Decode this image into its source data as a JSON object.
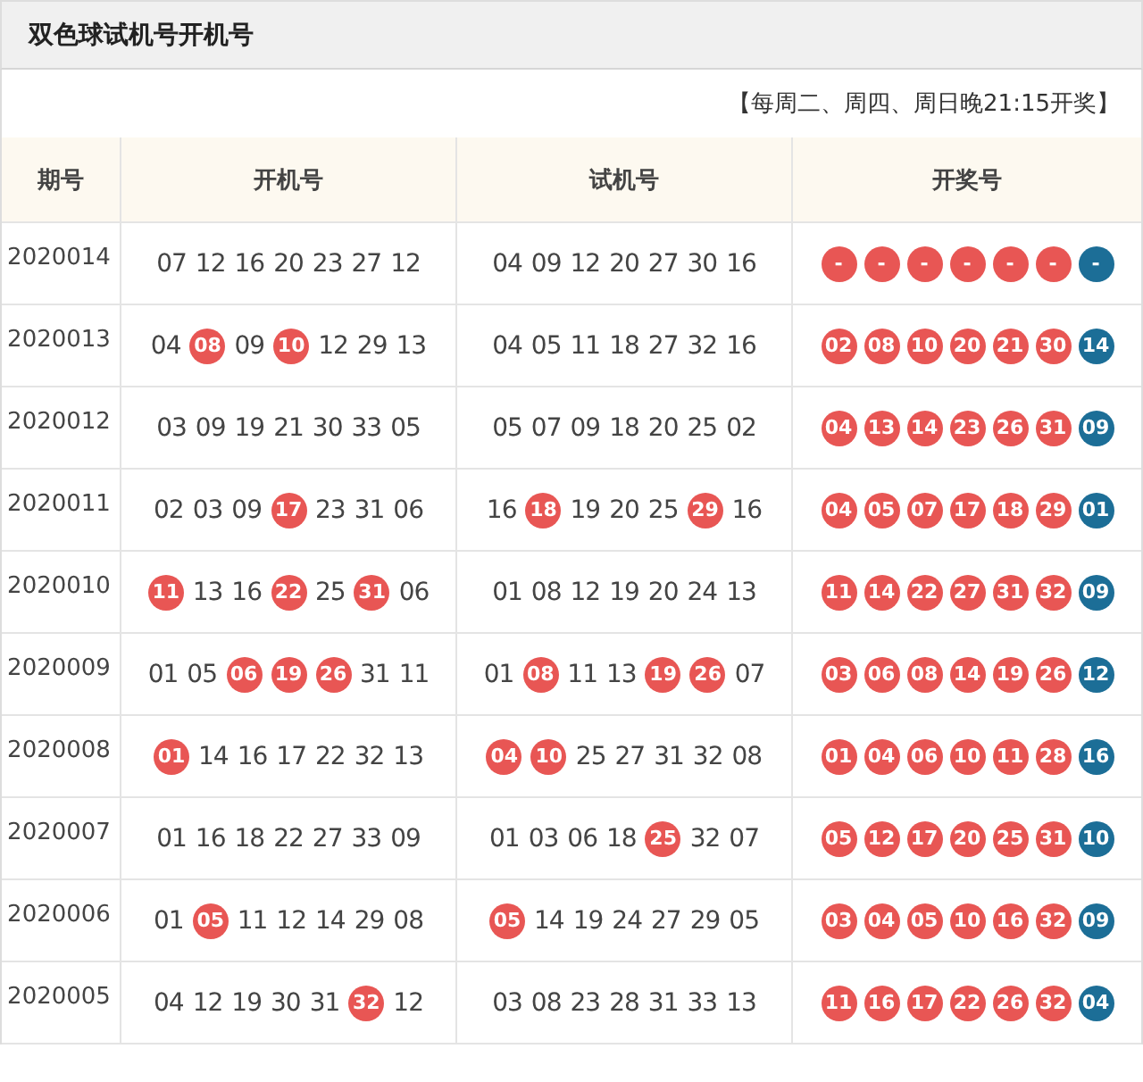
{
  "title": "双色球试机号开机号",
  "notice": "【每周二、周四、周日晚21:15开奖】",
  "columns": [
    "期号",
    "开机号",
    "试机号",
    "开奖号"
  ],
  "rows": [
    {
      "period": "2020014",
      "open": [
        {
          "n": "07",
          "hit": false
        },
        {
          "n": "12",
          "hit": false
        },
        {
          "n": "16",
          "hit": false
        },
        {
          "n": "20",
          "hit": false
        },
        {
          "n": "23",
          "hit": false
        },
        {
          "n": "27",
          "hit": false
        },
        {
          "n": "12",
          "hit": false
        }
      ],
      "test": [
        {
          "n": "04",
          "hit": false
        },
        {
          "n": "09",
          "hit": false
        },
        {
          "n": "12",
          "hit": false
        },
        {
          "n": "20",
          "hit": false
        },
        {
          "n": "27",
          "hit": false
        },
        {
          "n": "30",
          "hit": false
        },
        {
          "n": "16",
          "hit": false
        }
      ],
      "result": [
        {
          "n": "-",
          "color": "#e85654"
        },
        {
          "n": "-",
          "color": "#e85654"
        },
        {
          "n": "-",
          "color": "#e85654"
        },
        {
          "n": "-",
          "color": "#e85654"
        },
        {
          "n": "-",
          "color": "#e85654"
        },
        {
          "n": "-",
          "color": "#e85654"
        },
        {
          "n": "-",
          "color": "#1c6e97"
        }
      ]
    },
    {
      "period": "2020013",
      "open": [
        {
          "n": "04",
          "hit": false
        },
        {
          "n": "08",
          "hit": true
        },
        {
          "n": "09",
          "hit": false
        },
        {
          "n": "10",
          "hit": true
        },
        {
          "n": "12",
          "hit": false
        },
        {
          "n": "29",
          "hit": false
        },
        {
          "n": "13",
          "hit": false
        }
      ],
      "test": [
        {
          "n": "04",
          "hit": false
        },
        {
          "n": "05",
          "hit": false
        },
        {
          "n": "11",
          "hit": false
        },
        {
          "n": "18",
          "hit": false
        },
        {
          "n": "27",
          "hit": false
        },
        {
          "n": "32",
          "hit": false
        },
        {
          "n": "16",
          "hit": false
        }
      ],
      "result": [
        {
          "n": "02",
          "color": "#e85654"
        },
        {
          "n": "08",
          "color": "#e85654"
        },
        {
          "n": "10",
          "color": "#e85654"
        },
        {
          "n": "20",
          "color": "#e85654"
        },
        {
          "n": "21",
          "color": "#e85654"
        },
        {
          "n": "30",
          "color": "#e85654"
        },
        {
          "n": "14",
          "color": "#1c6e97"
        }
      ]
    },
    {
      "period": "2020012",
      "open": [
        {
          "n": "03",
          "hit": false
        },
        {
          "n": "09",
          "hit": false
        },
        {
          "n": "19",
          "hit": false
        },
        {
          "n": "21",
          "hit": false
        },
        {
          "n": "30",
          "hit": false
        },
        {
          "n": "33",
          "hit": false
        },
        {
          "n": "05",
          "hit": false
        }
      ],
      "test": [
        {
          "n": "05",
          "hit": false
        },
        {
          "n": "07",
          "hit": false
        },
        {
          "n": "09",
          "hit": false
        },
        {
          "n": "18",
          "hit": false
        },
        {
          "n": "20",
          "hit": false
        },
        {
          "n": "25",
          "hit": false
        },
        {
          "n": "02",
          "hit": false
        }
      ],
      "result": [
        {
          "n": "04",
          "color": "#e85654"
        },
        {
          "n": "13",
          "color": "#e85654"
        },
        {
          "n": "14",
          "color": "#e85654"
        },
        {
          "n": "23",
          "color": "#e85654"
        },
        {
          "n": "26",
          "color": "#e85654"
        },
        {
          "n": "31",
          "color": "#e85654"
        },
        {
          "n": "09",
          "color": "#1c6e97"
        }
      ]
    },
    {
      "period": "2020011",
      "open": [
        {
          "n": "02",
          "hit": false
        },
        {
          "n": "03",
          "hit": false
        },
        {
          "n": "09",
          "hit": false
        },
        {
          "n": "17",
          "hit": true
        },
        {
          "n": "23",
          "hit": false
        },
        {
          "n": "31",
          "hit": false
        },
        {
          "n": "06",
          "hit": false
        }
      ],
      "test": [
        {
          "n": "16",
          "hit": false
        },
        {
          "n": "18",
          "hit": true
        },
        {
          "n": "19",
          "hit": false
        },
        {
          "n": "20",
          "hit": false
        },
        {
          "n": "25",
          "hit": false
        },
        {
          "n": "29",
          "hit": true
        },
        {
          "n": "16",
          "hit": false
        }
      ],
      "result": [
        {
          "n": "04",
          "color": "#e85654"
        },
        {
          "n": "05",
          "color": "#e85654"
        },
        {
          "n": "07",
          "color": "#e85654"
        },
        {
          "n": "17",
          "color": "#e85654"
        },
        {
          "n": "18",
          "color": "#e85654"
        },
        {
          "n": "29",
          "color": "#e85654"
        },
        {
          "n": "01",
          "color": "#1c6e97"
        }
      ]
    },
    {
      "period": "2020010",
      "open": [
        {
          "n": "11",
          "hit": true
        },
        {
          "n": "13",
          "hit": false
        },
        {
          "n": "16",
          "hit": false
        },
        {
          "n": "22",
          "hit": true
        },
        {
          "n": "25",
          "hit": false
        },
        {
          "n": "31",
          "hit": true
        },
        {
          "n": "06",
          "hit": false
        }
      ],
      "test": [
        {
          "n": "01",
          "hit": false
        },
        {
          "n": "08",
          "hit": false
        },
        {
          "n": "12",
          "hit": false
        },
        {
          "n": "19",
          "hit": false
        },
        {
          "n": "20",
          "hit": false
        },
        {
          "n": "24",
          "hit": false
        },
        {
          "n": "13",
          "hit": false
        }
      ],
      "result": [
        {
          "n": "11",
          "color": "#e85654"
        },
        {
          "n": "14",
          "color": "#e85654"
        },
        {
          "n": "22",
          "color": "#e85654"
        },
        {
          "n": "27",
          "color": "#e85654"
        },
        {
          "n": "31",
          "color": "#e85654"
        },
        {
          "n": "32",
          "color": "#e85654"
        },
        {
          "n": "09",
          "color": "#1c6e97"
        }
      ]
    },
    {
      "period": "2020009",
      "open": [
        {
          "n": "01",
          "hit": false
        },
        {
          "n": "05",
          "hit": false
        },
        {
          "n": "06",
          "hit": true
        },
        {
          "n": "19",
          "hit": true
        },
        {
          "n": "26",
          "hit": true
        },
        {
          "n": "31",
          "hit": false
        },
        {
          "n": "11",
          "hit": false
        }
      ],
      "test": [
        {
          "n": "01",
          "hit": false
        },
        {
          "n": "08",
          "hit": true
        },
        {
          "n": "11",
          "hit": false
        },
        {
          "n": "13",
          "hit": false
        },
        {
          "n": "19",
          "hit": true
        },
        {
          "n": "26",
          "hit": true
        },
        {
          "n": "07",
          "hit": false
        }
      ],
      "result": [
        {
          "n": "03",
          "color": "#e85654"
        },
        {
          "n": "06",
          "color": "#e85654"
        },
        {
          "n": "08",
          "color": "#e85654"
        },
        {
          "n": "14",
          "color": "#e85654"
        },
        {
          "n": "19",
          "color": "#e85654"
        },
        {
          "n": "26",
          "color": "#e85654"
        },
        {
          "n": "12",
          "color": "#1c6e97"
        }
      ]
    },
    {
      "period": "2020008",
      "open": [
        {
          "n": "01",
          "hit": true
        },
        {
          "n": "14",
          "hit": false
        },
        {
          "n": "16",
          "hit": false
        },
        {
          "n": "17",
          "hit": false
        },
        {
          "n": "22",
          "hit": false
        },
        {
          "n": "32",
          "hit": false
        },
        {
          "n": "13",
          "hit": false
        }
      ],
      "test": [
        {
          "n": "04",
          "hit": true
        },
        {
          "n": "10",
          "hit": true
        },
        {
          "n": "25",
          "hit": false
        },
        {
          "n": "27",
          "hit": false
        },
        {
          "n": "31",
          "hit": false
        },
        {
          "n": "32",
          "hit": false
        },
        {
          "n": "08",
          "hit": false
        }
      ],
      "result": [
        {
          "n": "01",
          "color": "#e85654"
        },
        {
          "n": "04",
          "color": "#e85654"
        },
        {
          "n": "06",
          "color": "#e85654"
        },
        {
          "n": "10",
          "color": "#e85654"
        },
        {
          "n": "11",
          "color": "#e85654"
        },
        {
          "n": "28",
          "color": "#e85654"
        },
        {
          "n": "16",
          "color": "#1c6e97"
        }
      ]
    },
    {
      "period": "2020007",
      "open": [
        {
          "n": "01",
          "hit": false
        },
        {
          "n": "16",
          "hit": false
        },
        {
          "n": "18",
          "hit": false
        },
        {
          "n": "22",
          "hit": false
        },
        {
          "n": "27",
          "hit": false
        },
        {
          "n": "33",
          "hit": false
        },
        {
          "n": "09",
          "hit": false
        }
      ],
      "test": [
        {
          "n": "01",
          "hit": false
        },
        {
          "n": "03",
          "hit": false
        },
        {
          "n": "06",
          "hit": false
        },
        {
          "n": "18",
          "hit": false
        },
        {
          "n": "25",
          "hit": true
        },
        {
          "n": "32",
          "hit": false
        },
        {
          "n": "07",
          "hit": false
        }
      ],
      "result": [
        {
          "n": "05",
          "color": "#e85654"
        },
        {
          "n": "12",
          "color": "#e85654"
        },
        {
          "n": "17",
          "color": "#e85654"
        },
        {
          "n": "20",
          "color": "#e85654"
        },
        {
          "n": "25",
          "color": "#e85654"
        },
        {
          "n": "31",
          "color": "#e85654"
        },
        {
          "n": "10",
          "color": "#1c6e97"
        }
      ]
    },
    {
      "period": "2020006",
      "open": [
        {
          "n": "01",
          "hit": false
        },
        {
          "n": "05",
          "hit": true
        },
        {
          "n": "11",
          "hit": false
        },
        {
          "n": "12",
          "hit": false
        },
        {
          "n": "14",
          "hit": false
        },
        {
          "n": "29",
          "hit": false
        },
        {
          "n": "08",
          "hit": false
        }
      ],
      "test": [
        {
          "n": "05",
          "hit": true
        },
        {
          "n": "14",
          "hit": false
        },
        {
          "n": "19",
          "hit": false
        },
        {
          "n": "24",
          "hit": false
        },
        {
          "n": "27",
          "hit": false
        },
        {
          "n": "29",
          "hit": false
        },
        {
          "n": "05",
          "hit": false
        }
      ],
      "result": [
        {
          "n": "03",
          "color": "#e85654"
        },
        {
          "n": "04",
          "color": "#e85654"
        },
        {
          "n": "05",
          "color": "#e85654"
        },
        {
          "n": "10",
          "color": "#e85654"
        },
        {
          "n": "16",
          "color": "#e85654"
        },
        {
          "n": "32",
          "color": "#e85654"
        },
        {
          "n": "09",
          "color": "#1c6e97"
        }
      ]
    },
    {
      "period": "2020005",
      "open": [
        {
          "n": "04",
          "hit": false
        },
        {
          "n": "12",
          "hit": false
        },
        {
          "n": "19",
          "hit": false
        },
        {
          "n": "30",
          "hit": false
        },
        {
          "n": "31",
          "hit": false
        },
        {
          "n": "32",
          "hit": true
        },
        {
          "n": "12",
          "hit": false
        }
      ],
      "test": [
        {
          "n": "03",
          "hit": false
        },
        {
          "n": "08",
          "hit": false
        },
        {
          "n": "23",
          "hit": false
        },
        {
          "n": "28",
          "hit": false
        },
        {
          "n": "31",
          "hit": false
        },
        {
          "n": "33",
          "hit": false
        },
        {
          "n": "13",
          "hit": false
        }
      ],
      "result": [
        {
          "n": "11",
          "color": "#e85654"
        },
        {
          "n": "16",
          "color": "#e85654"
        },
        {
          "n": "17",
          "color": "#e85654"
        },
        {
          "n": "22",
          "color": "#e85654"
        },
        {
          "n": "26",
          "color": "#e85654"
        },
        {
          "n": "32",
          "color": "#e85654"
        },
        {
          "n": "04",
          "color": "#1c6e97"
        }
      ]
    }
  ]
}
